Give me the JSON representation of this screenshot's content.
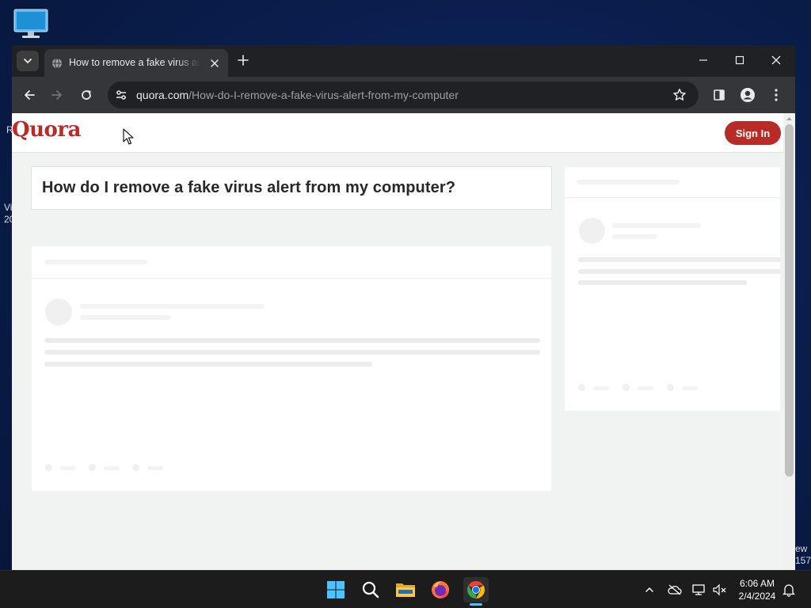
{
  "desktop": {
    "icon_name": "monitor-icon",
    "left_fragments": [
      "R",
      "Vi",
      "20"
    ],
    "right_fragments": [
      "ew",
      "157"
    ]
  },
  "browser": {
    "tab": {
      "title": "How to remove a fake virus alert from my computer",
      "favicon": "globe-icon"
    },
    "address_bar": {
      "host": "quora.com",
      "path": "/How-do-I-remove-a-fake-virus-alert-from-my-computer"
    }
  },
  "page": {
    "logo": "Quora",
    "sign_in_label": "Sign In",
    "question_title": "How do I remove a fake virus alert from my computer?",
    "brand_color": "#b92b27"
  },
  "taskbar": {
    "apps": [
      "start-icon",
      "search-icon",
      "file-explorer-icon",
      "firefox-icon",
      "chrome-icon"
    ],
    "active_app": "chrome-icon",
    "clock": {
      "time": "6:06 AM",
      "date": "2/4/2024"
    }
  }
}
